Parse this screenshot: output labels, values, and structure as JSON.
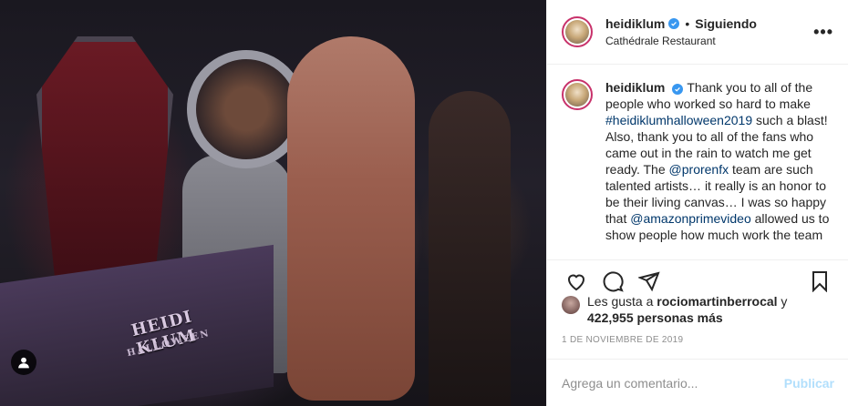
{
  "photo": {
    "cake_title": "HEIDI KLUM",
    "cake_subtitle": "HALLOWEEN"
  },
  "header": {
    "username": "heidiklum",
    "separator": "•",
    "follow_label": "Siguiendo",
    "location": "Cathédrale Restaurant",
    "more_icon": "more-icon"
  },
  "caption": {
    "username": "heidiklum",
    "text_1": "Thank you to all of the people who worked so hard to make ",
    "hashtag": "#heidiklumhalloween2019",
    "text_2": " such a blast! Also, thank you to all of the fans who came out in the rain to watch me get ready. The ",
    "mention_1": "@prorenfx",
    "text_3": " team are such talented artists… it really is an honor to be their living canvas… I was so happy that ",
    "mention_2": "@amazonprimevideo",
    "text_4": " allowed us to show people how much work the team"
  },
  "actions": {
    "like_icon": "heart-icon",
    "comment_icon": "comment-icon",
    "share_icon": "share-icon",
    "save_icon": "bookmark-icon"
  },
  "likes": {
    "prefix": "Les gusta a ",
    "user": "rociomartinberrocal",
    "joiner": " y",
    "count": "422,955 personas más"
  },
  "date": "1 DE NOVIEMBRE DE 2019",
  "add_comment": {
    "placeholder": "Agrega un comentario...",
    "post_label": "Publicar"
  },
  "colors": {
    "accent_blue": "#3897f0",
    "link": "#00376b",
    "post_disabled": "#b2dffc",
    "muted": "#8e8e8e"
  }
}
